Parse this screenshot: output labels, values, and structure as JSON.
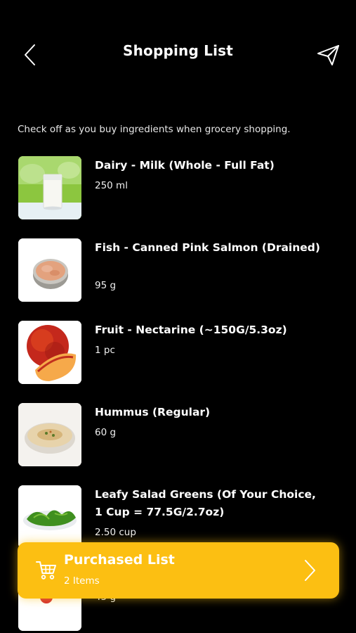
{
  "header": {
    "title": "Shopping List",
    "back_icon": "chevron-left-icon",
    "share_icon": "send-icon"
  },
  "instructions": "Check off as you buy ingredients when grocery shopping.",
  "items": [
    {
      "name": "Dairy - Milk (Whole - Full Fat)",
      "qty": "250 ml",
      "image": "milk-glass"
    },
    {
      "name": "Fish - Canned Pink Salmon (Drained)",
      "qty": "95 g",
      "image": "canned-salmon"
    },
    {
      "name": "Fruit - Nectarine (~150G/5.3oz)",
      "qty": "1 pc",
      "image": "nectarine"
    },
    {
      "name": "Hummus (Regular)",
      "qty": "60 g",
      "image": "hummus-bowl"
    },
    {
      "name": "Leafy Salad Greens (Of Your Choice, 1 Cup = 77.5G/2.7oz)",
      "qty": "2.50 cup",
      "image": "salad-greens"
    },
    {
      "name": "",
      "qty": "45 g",
      "image": "mixed-berries"
    }
  ],
  "purchased": {
    "title": "Purchased List",
    "count": "2 Items",
    "icon": "cart-icon",
    "accent": "#fcbf12"
  }
}
